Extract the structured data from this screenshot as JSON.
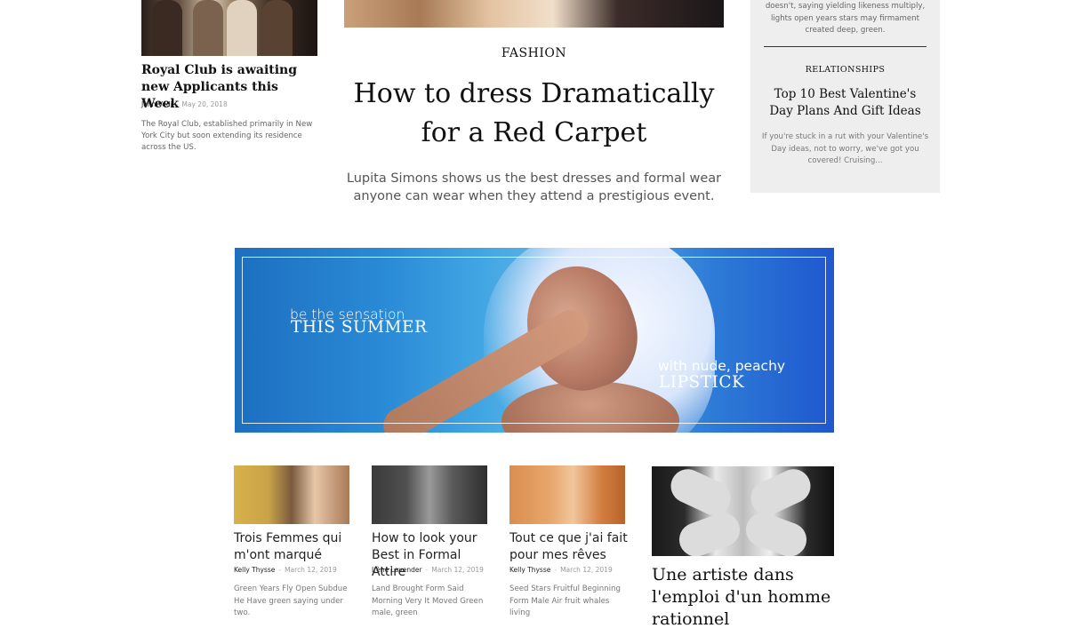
{
  "top_left_article": {
    "title": "Royal Club is awaiting new Applicants this Week",
    "author": "John Vedi",
    "date": "May 20, 2018",
    "excerpt": "The Royal Club, established primarily in New York City but soon extending its residence across the US."
  },
  "featured_article": {
    "category": "FASHION",
    "title": "How to dress Dramatically for a Red Carpet",
    "subtitle": "Lupita Simons shows us the best dresses and formal wear anyone can wear when they attend a prestigious event."
  },
  "sidebar": {
    "top_excerpt": "doesn't, saying yielding likeness multiply, lights open years stars may firmament created deep, green.",
    "category": "RELATIONSHIPS",
    "title": "Top 10 Best Valentine's Day Plans And Gift Ideas",
    "excerpt": "If you're stuck in a rut with your Valentine's Day ideas, not to worry, we've got you covered! Cruising..."
  },
  "banner": {
    "line1": "be the sensation",
    "line2": "THIS SUMMER",
    "line3": "with nude, peachy",
    "line4": "LIPSTICK"
  },
  "cards": [
    {
      "title": "Trois Femmes qui m'ont marqué",
      "author": "Kelly Thysse",
      "date": "March 12, 2019",
      "excerpt": "Green Years Fly Open Subdue He Have green saying under two."
    },
    {
      "title": "How to look your Best in Formal Attire",
      "author": "Irène Lavender",
      "date": "March 12, 2019",
      "excerpt": "Land Brought Form Said Morning Very It Moved Green male, green"
    },
    {
      "title": "Tout ce que j'ai fait pour mes rêves",
      "author": "Kelly Thysse",
      "date": "March 12, 2019",
      "excerpt": "Seed Stars Fruitful Beginning Form Male Air fruit whales living"
    }
  ],
  "big_card": {
    "title": "Une artiste dans l'emploi d'un homme rationnel"
  },
  "colors": {
    "sidebar_bg": "#eeeeee",
    "banner_blue": "#2a8ad6",
    "text_dark": "#111111",
    "text_muted": "#777777"
  }
}
